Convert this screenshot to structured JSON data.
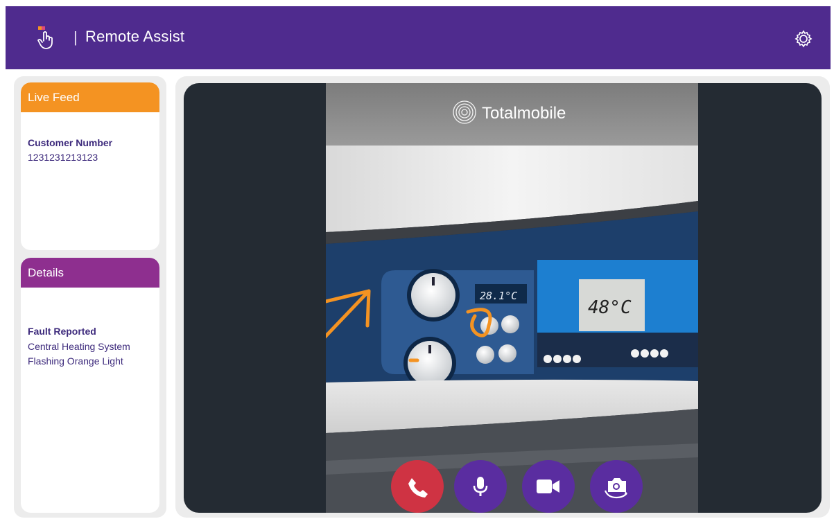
{
  "app": {
    "title": "Remote Assist",
    "separator": "|",
    "logo_icon": "hand-pointer-icon",
    "settings_icon": "gear-icon",
    "header_color": "#4f2b8e"
  },
  "live_feed_card": {
    "header": "Live Feed",
    "header_color": "#f49322",
    "customer_number_label": "Customer Number",
    "customer_number": "1231231213123"
  },
  "details_card": {
    "header": "Details",
    "header_color": "#8e2f8f",
    "fault_label": "Fault Reported",
    "fault_line1": "Central Heating System",
    "fault_line2": "Flashing Orange Light"
  },
  "video_feed": {
    "brand_watermark": "Totalmobile",
    "panel_small_display": "28.1°C",
    "panel_main_display": "48°C",
    "annotation_color": "#f49322"
  },
  "controls": [
    {
      "name": "end-call",
      "icon": "phone-icon",
      "color": "#cf3343"
    },
    {
      "name": "microphone",
      "icon": "microphone-icon",
      "color": "#5a2da0"
    },
    {
      "name": "video",
      "icon": "video-camera-icon",
      "color": "#5a2da0"
    },
    {
      "name": "switch-camera",
      "icon": "camera-rotate-icon",
      "color": "#5a2da0"
    }
  ]
}
